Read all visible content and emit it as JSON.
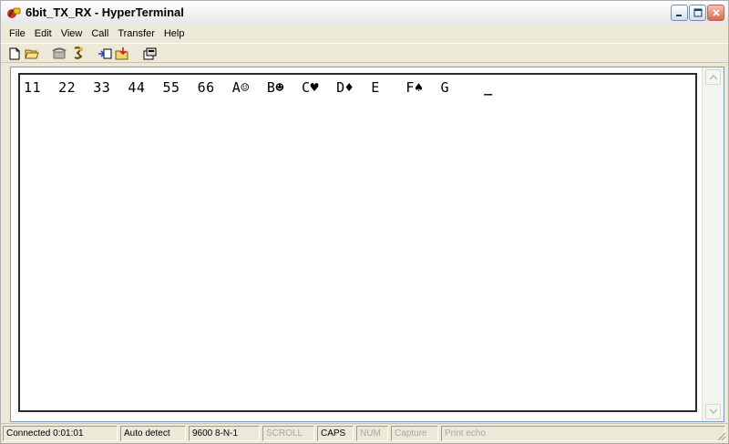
{
  "window": {
    "title": "6bit_TX_RX - HyperTerminal",
    "icon": "hyperterminal-app-icon",
    "controls": [
      "minimize-icon",
      "maximize-icon",
      "close-icon"
    ]
  },
  "menu": {
    "items": [
      {
        "label": "File"
      },
      {
        "label": "Edit"
      },
      {
        "label": "View"
      },
      {
        "label": "Call"
      },
      {
        "label": "Transfer"
      },
      {
        "label": "Help"
      }
    ]
  },
  "toolbar": {
    "buttons": [
      "new-file-icon",
      "open-folder-icon",
      "disconnect-phone-icon",
      "connect-icon",
      "send-file-icon",
      "receive-file-icon",
      "properties-icon"
    ]
  },
  "terminal": {
    "text": "11  22  33  44  55  66  A☺  B☻  C♥  D♦  E   F♠  G    ",
    "cursor": "_"
  },
  "statusbar": {
    "connected": "Connected 0:01:01",
    "detect": "Auto detect",
    "settings": "9600 8-N-1",
    "scroll": "SCROLL",
    "caps": "CAPS",
    "num": "NUM",
    "capture": "Capture",
    "print_echo": "Print echo"
  }
}
